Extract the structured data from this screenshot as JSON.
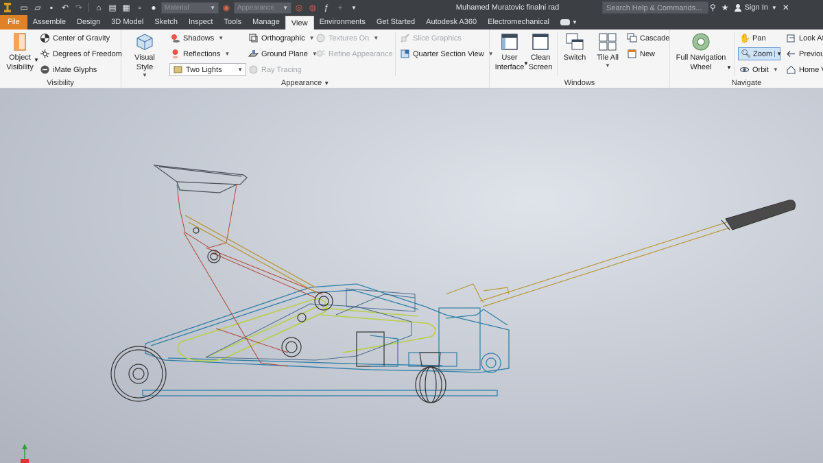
{
  "titlebar": {
    "material_placeholder": "Material",
    "appearance_placeholder": "Appearance",
    "document_title": "Muhamed Muratovic finalni rad",
    "search_placeholder": "Search Help & Commands...",
    "sign_in": "Sign In"
  },
  "tabs": [
    {
      "label": "File"
    },
    {
      "label": "Assemble"
    },
    {
      "label": "Design"
    },
    {
      "label": "3D Model"
    },
    {
      "label": "Sketch"
    },
    {
      "label": "Inspect"
    },
    {
      "label": "Tools"
    },
    {
      "label": "Manage"
    },
    {
      "label": "View",
      "active": true
    },
    {
      "label": "Environments"
    },
    {
      "label": "Get Started"
    },
    {
      "label": "Autodesk A360"
    },
    {
      "label": "Electromechanical"
    }
  ],
  "ribbon": {
    "visibility": {
      "title": "Visibility",
      "object_visibility_line1": "Object",
      "object_visibility_line2": "Visibility",
      "center_of_gravity": "Center of Gravity",
      "degrees_of_freedom": "Degrees of Freedom",
      "imate_glyphs": "iMate Glyphs"
    },
    "appearance": {
      "title": "Appearance",
      "visual_style": "Visual Style",
      "shadows": "Shadows",
      "reflections": "Reflections",
      "lighting": "Two Lights",
      "orthographic": "Orthographic",
      "ground_plane": "Ground Plane",
      "ray_tracing": "Ray Tracing",
      "textures_on": "Textures On",
      "refine_appearance": "Refine Appearance",
      "slice_graphics": "Slice Graphics",
      "quarter_section_view": "Quarter Section View"
    },
    "windows": {
      "title": "Windows",
      "user_interface_line1": "User",
      "user_interface_line2": "Interface",
      "clean_screen_line1": "Clean",
      "clean_screen_line2": "Screen",
      "switch": "Switch",
      "tile_all": "Tile All",
      "cascade": "Cascade",
      "new": "New"
    },
    "navigate": {
      "title": "Navigate",
      "full_nav_line1": "Full Navigation",
      "full_nav_line2": "Wheel",
      "pan": "Pan",
      "zoom": "Zoom",
      "orbit": "Orbit",
      "look_at": "Look At",
      "previous": "Previous",
      "home_view": "Home V"
    }
  },
  "colors": {
    "titlebar_bg": "#3c3f44",
    "file_tab": "#e08128",
    "ribbon_bg": "#f5f5f5",
    "wire_blue": "#2f7fa6",
    "wire_green": "#b9cf45",
    "wire_red": "#b04a36",
    "wire_gold": "#b89a3a",
    "handle_grip": "#4a4a4a"
  }
}
